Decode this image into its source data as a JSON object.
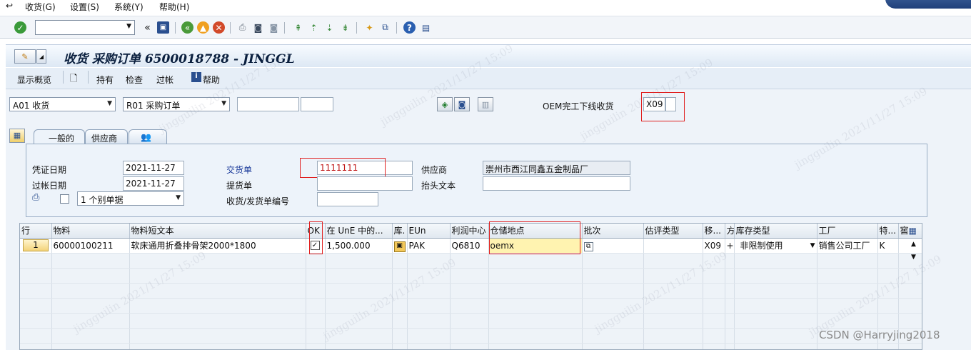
{
  "menubar": {
    "items": [
      "收货(G)",
      "设置(S)",
      "系统(Y)",
      "帮助(H)"
    ]
  },
  "toolbar": {
    "command_field": "",
    "icons": [
      "check-icon",
      "command-dropdown",
      "back-double-icon",
      "save-icon",
      "back-icon",
      "exit-icon",
      "cancel-icon",
      "print-icon",
      "find-icon",
      "find-next-icon",
      "first-page-icon",
      "prev-page-icon",
      "next-page-icon",
      "last-page-icon",
      "new-session-icon",
      "shortcut-icon",
      "help-icon",
      "customize-icon"
    ]
  },
  "title": "收货 采购订单 6500018788 - JINGGL",
  "app_toolbar": {
    "overview": "显示概览",
    "hold": "持有",
    "check": "检查",
    "post": "过帐",
    "help": "帮助"
  },
  "header": {
    "transaction": "A01 收货",
    "reference": "R01 采购订单",
    "ref_doc_no": "",
    "ref_item": "",
    "oem_label": "OEM完工下线收货",
    "movement_type": "X09"
  },
  "tabs": [
    "一般的",
    "供应商"
  ],
  "general": {
    "doc_date_label": "凭证日期",
    "doc_date": "2021-11-27",
    "post_date_label": "过帐日期",
    "post_date": "2021-11-27",
    "slip_option": "1 个别单据",
    "delivery_note_label": "交货单",
    "delivery_note": "1111111",
    "bill_of_lading_label": "提货单",
    "bill_of_lading": "",
    "gr_slip_label": "收货/发货单编号",
    "gr_slip": "",
    "vendor_label": "供应商",
    "vendor": "崇州市西江同鑫五金制品厂",
    "header_text_label": "抬头文本",
    "header_text": ""
  },
  "grid": {
    "columns": [
      "行",
      "物料",
      "物料短文本",
      "OK",
      "在 UnE 中的...",
      "库.",
      "EUn",
      "利润中心",
      "仓储地点",
      "批次",
      "估评类型",
      "移...",
      "方",
      "库存类型",
      "工厂",
      "特...",
      "窖"
    ],
    "rows": [
      {
        "line": "1",
        "material": "60000100211",
        "short_text": "软床通用折叠排骨架2000*1800",
        "ok": "✓",
        "qty": "1,500.000",
        "eun": "PAK",
        "profit_center": "Q6810",
        "storage_location": "oemx",
        "batch": "",
        "valuation_type": "",
        "movement": "X09",
        "direction": "+",
        "stock_type": "非限制使用",
        "plant": "销售公司工厂",
        "special": "K"
      }
    ]
  },
  "watermark_text": "jingguilin 2021/11/27 15:09",
  "csdn": "CSDN @Harryjing2018"
}
